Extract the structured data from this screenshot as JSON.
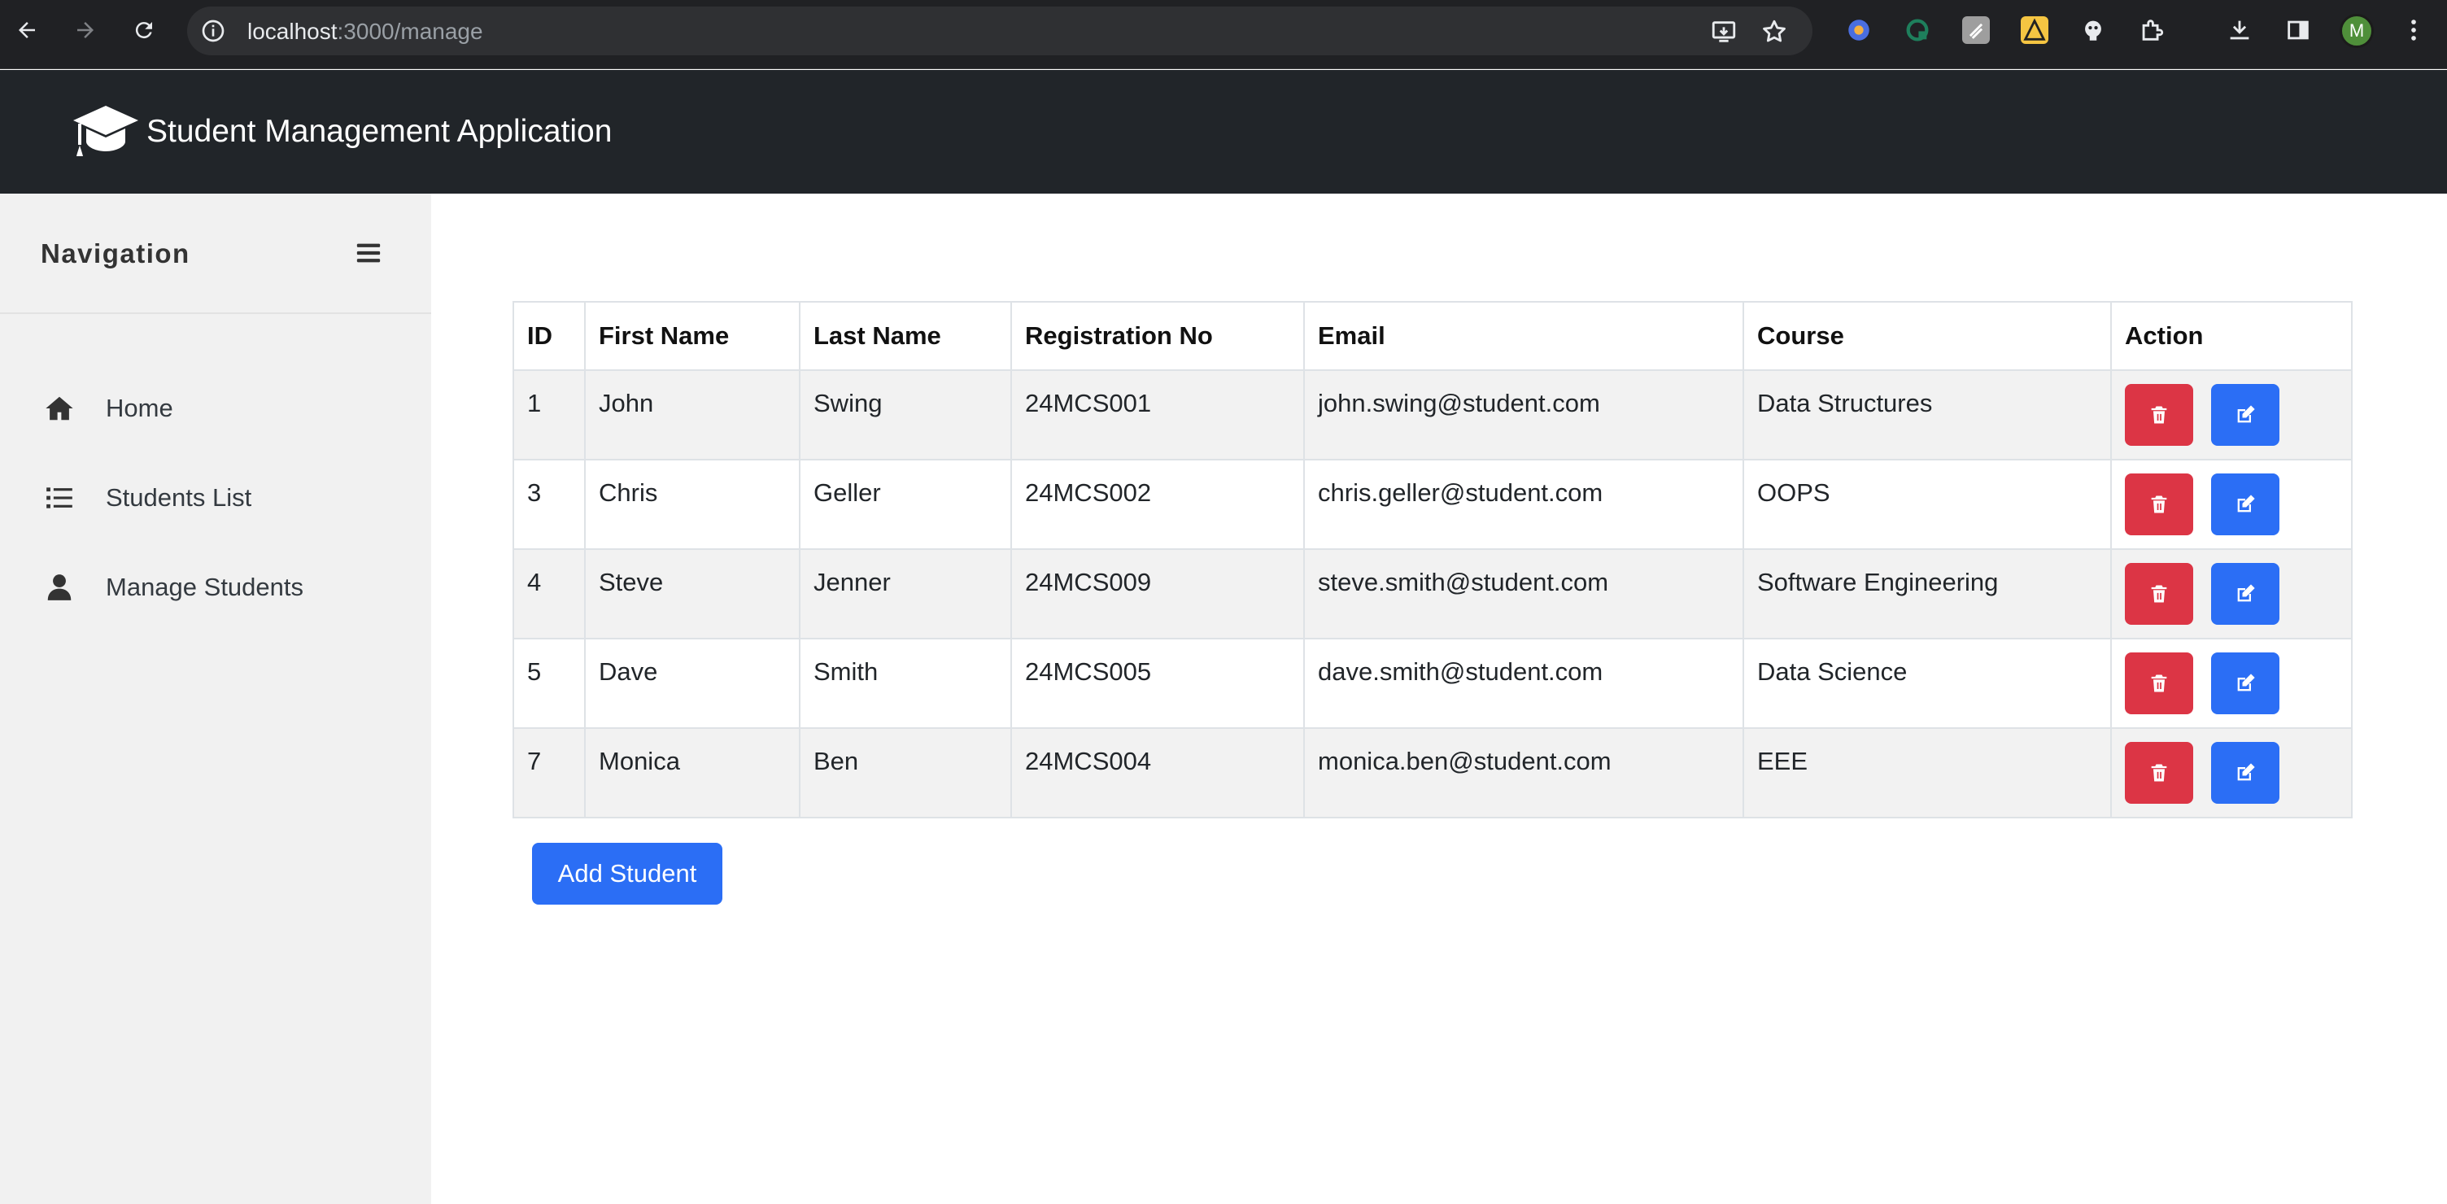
{
  "browser": {
    "url_host": "localhost",
    "url_path": ":3000/manage",
    "profile_initial": "M"
  },
  "header": {
    "title": "Student Management Application"
  },
  "sidebar": {
    "title": "Navigation",
    "items": [
      {
        "label": "Home",
        "icon": "home-icon"
      },
      {
        "label": "Students List",
        "icon": "list-icon"
      },
      {
        "label": "Manage Students",
        "icon": "user-icon"
      }
    ]
  },
  "table": {
    "headers": [
      "ID",
      "First Name",
      "Last Name",
      "Registration No",
      "Email",
      "Course",
      "Action"
    ],
    "rows": [
      [
        "1",
        "John",
        "Swing",
        "24MCS001",
        "john.swing@student.com",
        "Data Structures"
      ],
      [
        "3",
        "Chris",
        "Geller",
        "24MCS002",
        "chris.geller@student.com",
        "OOPS"
      ],
      [
        "4",
        "Steve",
        "Jenner",
        "24MCS009",
        "steve.smith@student.com",
        "Software Engineering"
      ],
      [
        "5",
        "Dave",
        "Smith",
        "24MCS005",
        "dave.smith@student.com",
        "Data Science"
      ],
      [
        "7",
        "Monica",
        "Ben",
        "24MCS004",
        "monica.ben@student.com",
        "EEE"
      ]
    ]
  },
  "actions": {
    "add_label": "Add Student"
  },
  "colors": {
    "header_bg": "#212529",
    "sidebar_bg": "#f1f1f1",
    "danger": "#dc3545",
    "primary": "#2b6ef5"
  }
}
